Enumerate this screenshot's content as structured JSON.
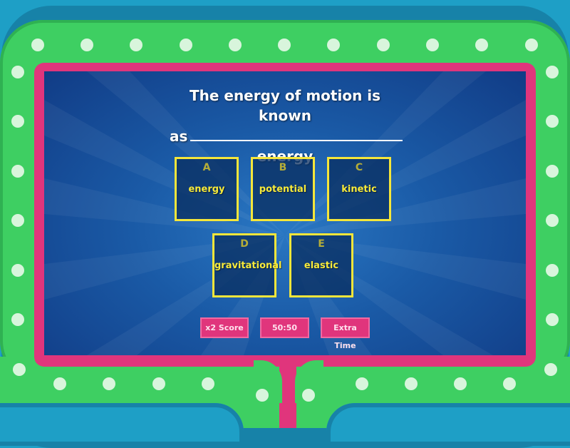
{
  "question": {
    "line1": "The energy of motion is known",
    "line2_prefix": "as",
    "line3": "energy"
  },
  "answers": [
    {
      "letter": "A",
      "text": "energy"
    },
    {
      "letter": "B",
      "text": "potential"
    },
    {
      "letter": "C",
      "text": "kinetic"
    },
    {
      "letter": "D",
      "text": "gravitational"
    },
    {
      "letter": "E",
      "text": "elastic"
    }
  ],
  "powerups": {
    "double_score": "x2 Score",
    "fifty_fifty": "50:50",
    "extra_time": "Extra Time"
  },
  "colors": {
    "frame_outer": "#1e9fc6",
    "frame_green": "#3ecf62",
    "frame_pink": "#e0357c",
    "screen_blue": "#1a5aa6",
    "answer_border": "#f5e63a",
    "answer_text": "#f7ea3b"
  }
}
